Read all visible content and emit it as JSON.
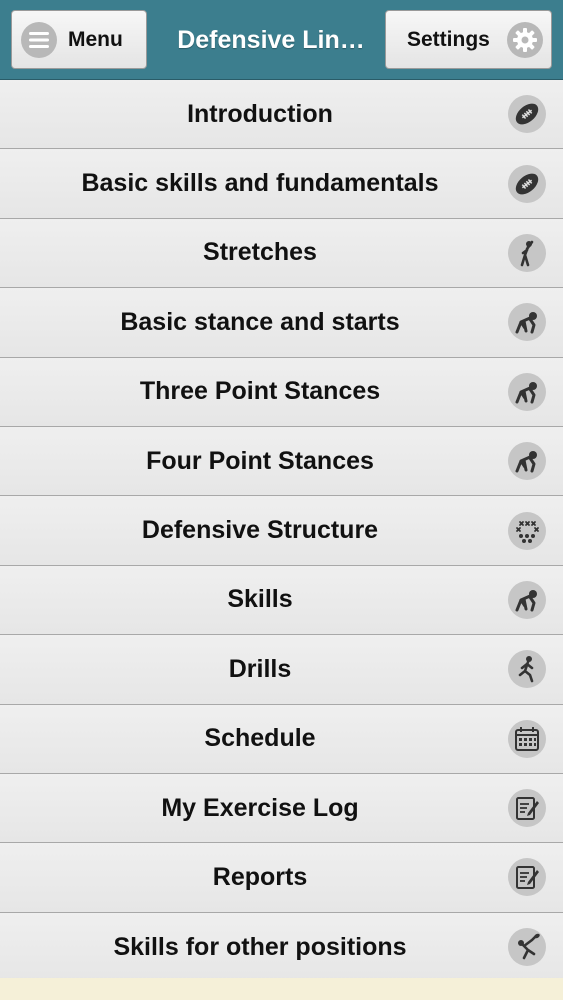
{
  "header": {
    "menu_label": "Menu",
    "menu_icon": "hamburger-icon",
    "title": "Defensive Lin…",
    "settings_label": "Settings",
    "settings_icon": "gear-icon",
    "bar_color": "#3c7e8e"
  },
  "list": {
    "items": [
      {
        "label": "Introduction",
        "icon": "football-icon"
      },
      {
        "label": "Basic skills and fundamentals",
        "icon": "football-icon"
      },
      {
        "label": "Stretches",
        "icon": "stretching-figure-icon"
      },
      {
        "label": "Basic stance and starts",
        "icon": "lineman-stance-icon"
      },
      {
        "label": "Three Point Stances",
        "icon": "lineman-stance-icon"
      },
      {
        "label": "Four Point Stances",
        "icon": "lineman-stance-icon"
      },
      {
        "label": "Defensive Structure",
        "icon": "formation-icon"
      },
      {
        "label": "Skills",
        "icon": "lineman-stance-icon"
      },
      {
        "label": "Drills",
        "icon": "running-figure-icon"
      },
      {
        "label": "Schedule",
        "icon": "calendar-icon"
      },
      {
        "label": "My Exercise Log",
        "icon": "notepad-icon"
      },
      {
        "label": "Reports",
        "icon": "notepad-icon"
      },
      {
        "label": "Skills for other positions",
        "icon": "player-throwing-icon"
      }
    ]
  }
}
